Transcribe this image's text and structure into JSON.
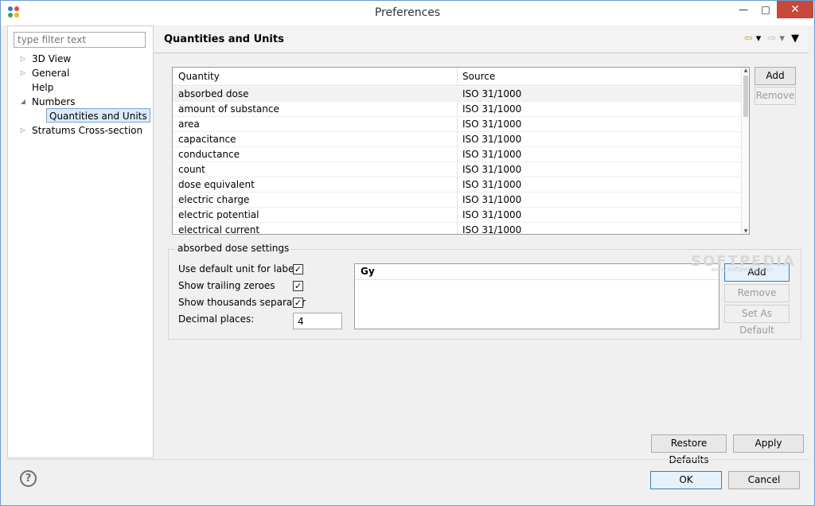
{
  "window": {
    "title": "Preferences",
    "minimize_glyph": "—",
    "maximize_glyph": "□",
    "close_glyph": "✕",
    "app_icon_colors": [
      "#2d7fd1",
      "#e64a3c",
      "#3aa655",
      "#f0b91e"
    ]
  },
  "filter": {
    "placeholder": "type filter text",
    "value": ""
  },
  "tree": {
    "items": [
      {
        "label": "3D View",
        "twisty": "▷"
      },
      {
        "label": "General",
        "twisty": "▷"
      },
      {
        "label": "Help",
        "twisty": ""
      },
      {
        "label": "Numbers",
        "twisty": "◢"
      },
      {
        "label": "Quantities and Units",
        "twisty": ""
      },
      {
        "label": "Stratums Cross-section",
        "twisty": "▷"
      }
    ],
    "selected": "Quantities and Units"
  },
  "page": {
    "title": "Quantities and Units",
    "nav": {
      "back": "⇦",
      "back_menu": "▾",
      "forward": "⇨",
      "forward_menu": "▾",
      "view_menu": "▼"
    }
  },
  "table": {
    "columns": [
      "Quantity",
      "Source"
    ],
    "rows": [
      [
        "absorbed dose",
        "ISO 31/1000"
      ],
      [
        "amount of substance",
        "ISO 31/1000"
      ],
      [
        "area",
        "ISO 31/1000"
      ],
      [
        "capacitance",
        "ISO 31/1000"
      ],
      [
        "conductance",
        "ISO 31/1000"
      ],
      [
        "count",
        "ISO 31/1000"
      ],
      [
        "dose equivalent",
        "ISO 31/1000"
      ],
      [
        "electric charge",
        "ISO 31/1000"
      ],
      [
        "electric potential",
        "ISO 31/1000"
      ],
      [
        "electrical current",
        "ISO 31/1000"
      ]
    ],
    "selected_row": 0,
    "add_label": "Add",
    "remove_label": "Remove"
  },
  "settings": {
    "group_title": "absorbed dose settings",
    "options": [
      {
        "label": "Use default unit for labels",
        "checked": true
      },
      {
        "label": "Show trailing zeroes",
        "checked": true
      },
      {
        "label": "Show thousands separator",
        "checked": true
      }
    ],
    "check_glyph": "✓",
    "decimal_label": "Decimal places:",
    "decimal_value": "4",
    "units_header": "Gy",
    "add_label": "Add",
    "remove_label": "Remove",
    "set_default_label": "Set As Default"
  },
  "watermark": {
    "text": "SOFTPEDIA",
    "sub": "www.softpedia.com"
  },
  "footer": {
    "restore_label": "Restore Defaults",
    "apply_label": "Apply",
    "ok_label": "OK",
    "cancel_label": "Cancel",
    "help_glyph": "?"
  }
}
